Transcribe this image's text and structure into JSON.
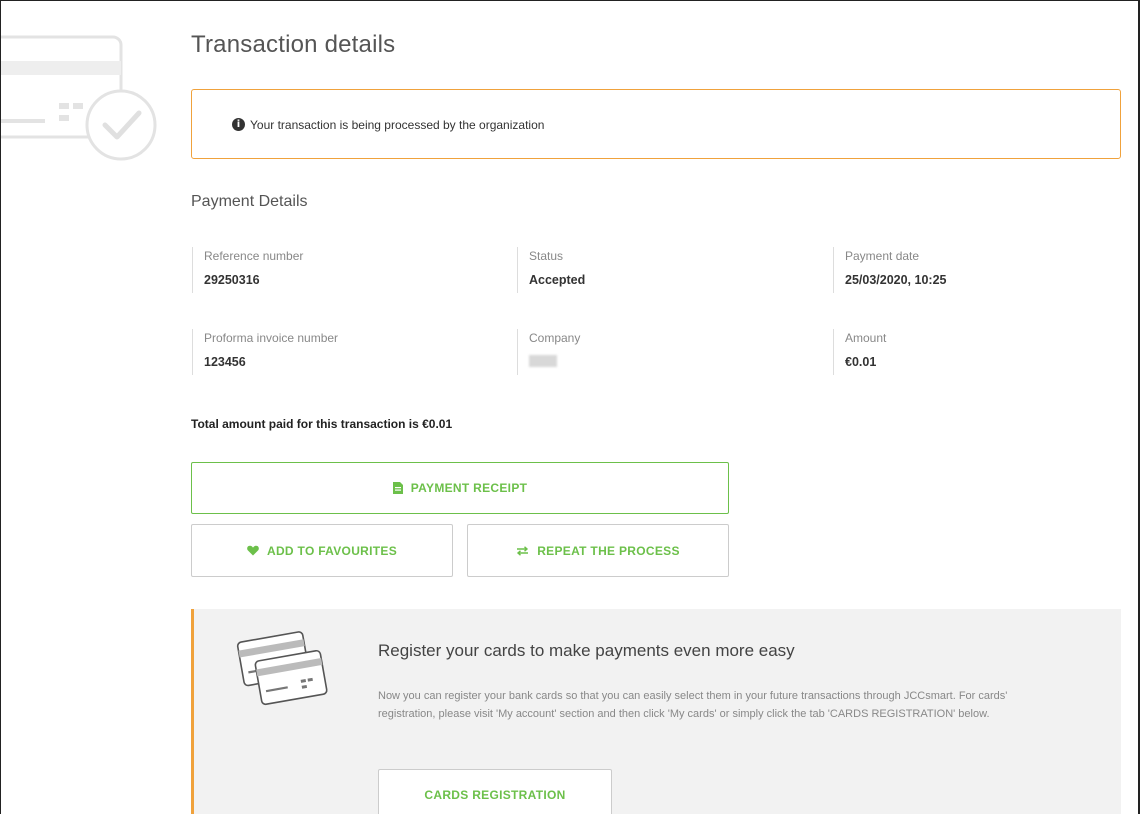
{
  "page": {
    "title": "Transaction details"
  },
  "notice": {
    "text": "Your transaction is being processed by the organization",
    "icon": "info-icon"
  },
  "payment_details": {
    "heading": "Payment Details",
    "fields": [
      {
        "label": "Reference number",
        "value": "29250316"
      },
      {
        "label": "Status",
        "value": "Accepted"
      },
      {
        "label": "Payment date",
        "value": "25/03/2020, 10:25"
      },
      {
        "label": "Proforma invoice number",
        "value": "123456"
      },
      {
        "label": "Company",
        "value": ""
      },
      {
        "label": "Amount",
        "value": "€0.01"
      }
    ]
  },
  "total": {
    "text": "Total amount paid for this transaction is €0.01"
  },
  "actions": {
    "receipt_label": "PAYMENT RECEIPT",
    "favourites_label": "ADD TO FAVOURITES",
    "repeat_label": "REPEAT THE PROCESS"
  },
  "promo": {
    "title": "Register your cards to make payments even more easy",
    "body": "Now you can register your bank cards so that you can easily select them in your future transactions through JCCsmart. For cards' registration, please visit 'My account' section and then click 'My cards' or simply click the tab 'CARDS REGISTRATION' below.",
    "button_label": "CARDS REGISTRATION"
  },
  "colors": {
    "accent_green": "#6cc04a",
    "accent_orange": "#f0a23c",
    "panel_gray": "#f2f2f2"
  }
}
